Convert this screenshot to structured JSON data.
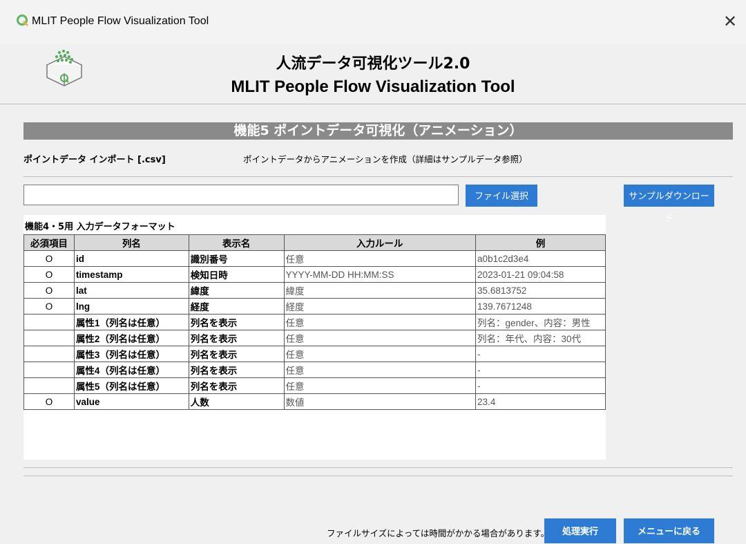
{
  "window": {
    "title": "MLIT People Flow Visualization Tool",
    "close_glyph": "✕"
  },
  "header": {
    "title_jp": "人流データ可視化ツール2.0",
    "title_en": "MLIT People Flow Visualization Tool"
  },
  "banner": {
    "text": "機能5 ポイントデータ可視化（アニメーション）"
  },
  "import": {
    "label": "ポイントデータ インポート [.csv]",
    "description": "ポイントデータからアニメーションを作成（詳細はサンプルデータ参照）",
    "file_path_value": "",
    "file_button": "ファイル選択",
    "sample_button": "サンプルダウンロード"
  },
  "format_table": {
    "caption": "機能4・5用 入力データフォーマット",
    "headers": [
      "必須項目",
      "列名",
      "表示名",
      "入力ルール",
      "例"
    ],
    "rows": [
      [
        "O",
        "id",
        "識別番号",
        "任意",
        "a0b1c2d3e4"
      ],
      [
        "O",
        "timestamp",
        "検知日時",
        "YYYY-MM-DD HH:MM:SS",
        "2023-01-21 09:04:58"
      ],
      [
        "O",
        "lat",
        "緯度",
        "緯度",
        "35.6813752"
      ],
      [
        "O",
        "lng",
        "経度",
        "経度",
        "139.7671248"
      ],
      [
        "",
        "属性1（列名は任意）",
        "列名を表示",
        "任意",
        "列名：gender、内容：男性"
      ],
      [
        "",
        "属性2（列名は任意）",
        "列名を表示",
        "任意",
        "列名：年代、内容：30代"
      ],
      [
        "",
        "属性3（列名は任意）",
        "列名を表示",
        "任意",
        "-"
      ],
      [
        "",
        "属性4（列名は任意）",
        "列名を表示",
        "任意",
        "-"
      ],
      [
        "",
        "属性5（列名は任意）",
        "列名を表示",
        "任意",
        "-"
      ],
      [
        "O",
        "value",
        "人数",
        "数値",
        "23.4"
      ]
    ]
  },
  "footer": {
    "note": "ファイルサイズによっては時間がかかる場合があります。",
    "execute_button": "処理実行",
    "back_button": "メニューに戻る"
  },
  "colors": {
    "accent": "#2e7bd3",
    "banner": "#8a8a8a",
    "logo_green": "#4caf50"
  },
  "icons": {
    "app": "qgis-logo-icon",
    "header": "data-box-icon",
    "close": "close-icon"
  }
}
